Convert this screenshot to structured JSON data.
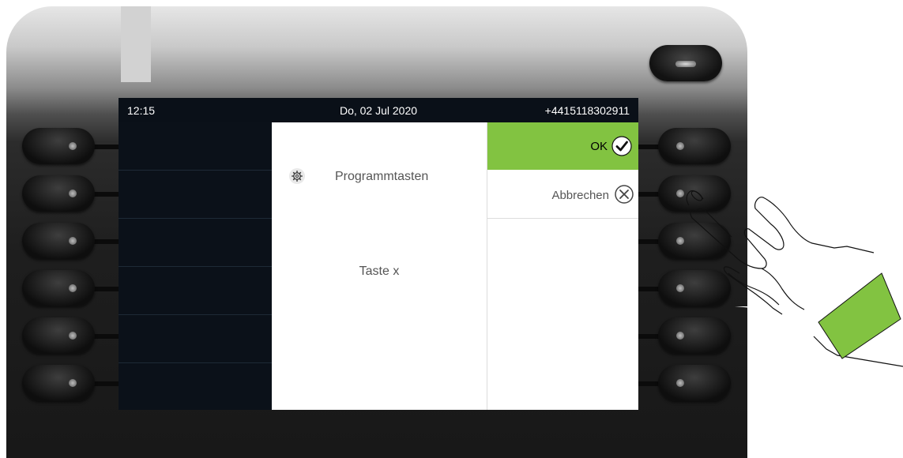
{
  "statusbar": {
    "time": "12:15",
    "date": "Do, 02 Jul 2020",
    "phone_number": "+4415118302911"
  },
  "menu": {
    "title": "Programmtasten",
    "title_icon": "gear-icon",
    "key_label": "Taste x"
  },
  "actions": {
    "ok_label": "OK",
    "ok_icon": "check-circle-icon",
    "cancel_label": "Abbrechen",
    "cancel_icon": "close-circle-icon"
  },
  "colors": {
    "accent_green": "#82c341",
    "screen_dark": "#0a0f16"
  }
}
